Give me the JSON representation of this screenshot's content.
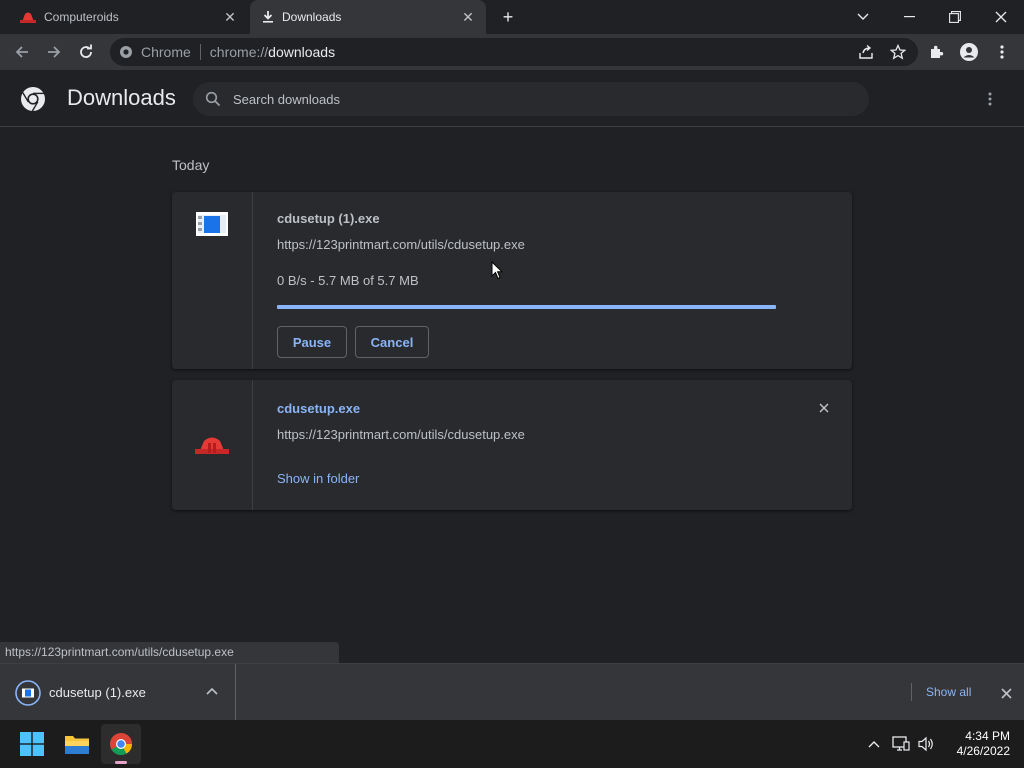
{
  "tabs": [
    {
      "title": "Computeroids",
      "active": false
    },
    {
      "title": "Downloads",
      "active": true
    }
  ],
  "omnibox": {
    "chip": "Chrome",
    "url_scheme": "chrome://",
    "url_host": "downloads"
  },
  "downloads_page": {
    "title": "Downloads",
    "search_placeholder": "Search downloads",
    "date_group": "Today",
    "items": [
      {
        "filename": "cdusetup (1).exe",
        "url": "https://123printmart.com/utils/cdusetup.exe",
        "status": "0 B/s - 5.7 MB of 5.7 MB",
        "progress": 1.0,
        "pause_label": "Pause",
        "cancel_label": "Cancel"
      },
      {
        "filename": "cdusetup.exe",
        "url": "https://123printmart.com/utils/cdusetup.exe",
        "action_label": "Show in folder"
      }
    ]
  },
  "status_bubble": "https://123printmart.com/utils/cdusetup.exe",
  "shelf": {
    "file_name": "cdusetup (1).exe",
    "show_all": "Show all"
  },
  "taskbar": {
    "time": "4:34 PM",
    "date": "4/26/2022"
  },
  "colors": {
    "accent": "#8ab4f8",
    "background": "#202124",
    "card": "#292a2d",
    "toolbar": "#35363a"
  }
}
